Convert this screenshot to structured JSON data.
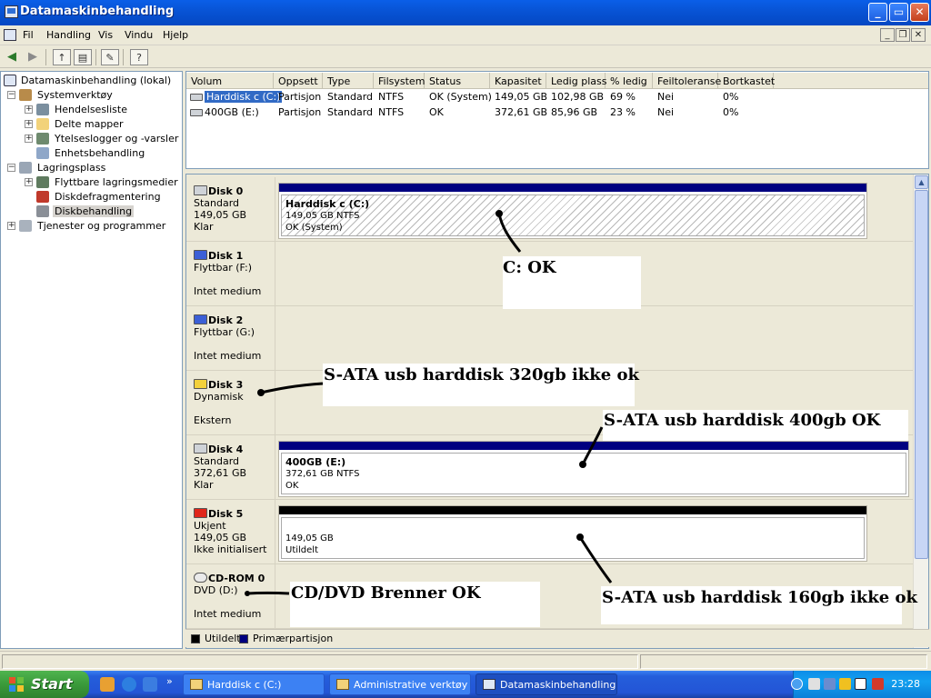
{
  "window": {
    "title": "Datamaskinbehandling",
    "minimize": "_",
    "maximize": "▭",
    "close": "✕"
  },
  "menu": {
    "items": [
      "Fil",
      "Handling",
      "Vis",
      "Vindu",
      "Hjelp"
    ]
  },
  "tree": {
    "root": "Datamaskinbehandling (lokal)",
    "system_tools": "Systemverktøy",
    "event_viewer": "Hendelsesliste",
    "shared_folders": "Delte mapper",
    "perf_logs": "Ytelseslogger og -varsler",
    "device_manager": "Enhetsbehandling",
    "storage": "Lagringsplass",
    "removable": "Flyttbare lagringsmedier",
    "defrag": "Diskdefragmentering",
    "disk_mgmt": "Diskbehandling",
    "services": "Tjenester og programmer"
  },
  "list": {
    "headers": [
      "Volum",
      "Oppsett",
      "Type",
      "Filsystem",
      "Status",
      "Kapasitet",
      "Ledig plass",
      "% ledig",
      "Feiltoleranse",
      "Bortkastet"
    ],
    "rows": [
      [
        "Harddisk c (C:)",
        "Partisjon",
        "Standard",
        "NTFS",
        "OK (System)",
        "149,05 GB",
        "102,98 GB",
        "69 %",
        "Nei",
        "0%"
      ],
      [
        "400GB (E:)",
        "Partisjon",
        "Standard",
        "NTFS",
        "OK",
        "372,61 GB",
        "85,96 GB",
        "23 %",
        "Nei",
        "0%"
      ]
    ]
  },
  "disks": {
    "d0": {
      "name": "Disk 0",
      "l1": "Standard",
      "l2": "149,05 GB",
      "l3": "Klar",
      "part_name": "Harddisk c  (C:)",
      "part_l1": "149,05 GB NTFS",
      "part_l2": "OK (System)"
    },
    "d1": {
      "name": "Disk 1",
      "l1": "Flyttbar (F:)",
      "l3": "Intet medium"
    },
    "d2": {
      "name": "Disk 2",
      "l1": "Flyttbar (G:)",
      "l3": "Intet medium"
    },
    "d3": {
      "name": "Disk 3",
      "l1": "Dynamisk",
      "l3": "Ekstern"
    },
    "d4": {
      "name": "Disk 4",
      "l1": "Standard",
      "l2": "372,61 GB",
      "l3": "Klar",
      "part_name": "400GB  (E:)",
      "part_l1": "372,61 GB NTFS",
      "part_l2": "OK"
    },
    "d5": {
      "name": "Disk 5",
      "l1": "Ukjent",
      "l2": "149,05 GB",
      "l3": "Ikke initialisert",
      "part_l1": "149,05 GB",
      "part_l2": "Utildelt"
    },
    "cd0": {
      "name": "CD-ROM 0",
      "l1": "DVD (D:)",
      "l3": "Intet medium"
    }
  },
  "legend": {
    "unallocated": "Utildelt",
    "primary": "Primærpartisjon",
    "unallocated_color": "#000000",
    "primary_color": "#000080"
  },
  "annotations": {
    "c_ok": "C: OK",
    "disk3": "S-ATA usb harddisk 320gb ikke ok",
    "disk4": "S-ATA usb harddisk 400gb OK",
    "disk5": "S-ATA usb harddisk 160gb ikke ok",
    "cdrom": "CD/DVD Brenner OK"
  },
  "taskbar": {
    "start": "Start",
    "tasks": [
      "Harddisk c (C:)",
      "Administrative verktøy",
      "Datamaskinbehandling"
    ],
    "clock": "23:28"
  },
  "colors": {
    "titlebar": "#0854d6",
    "primary_partition": "#000080",
    "selection": "#316ac5"
  }
}
